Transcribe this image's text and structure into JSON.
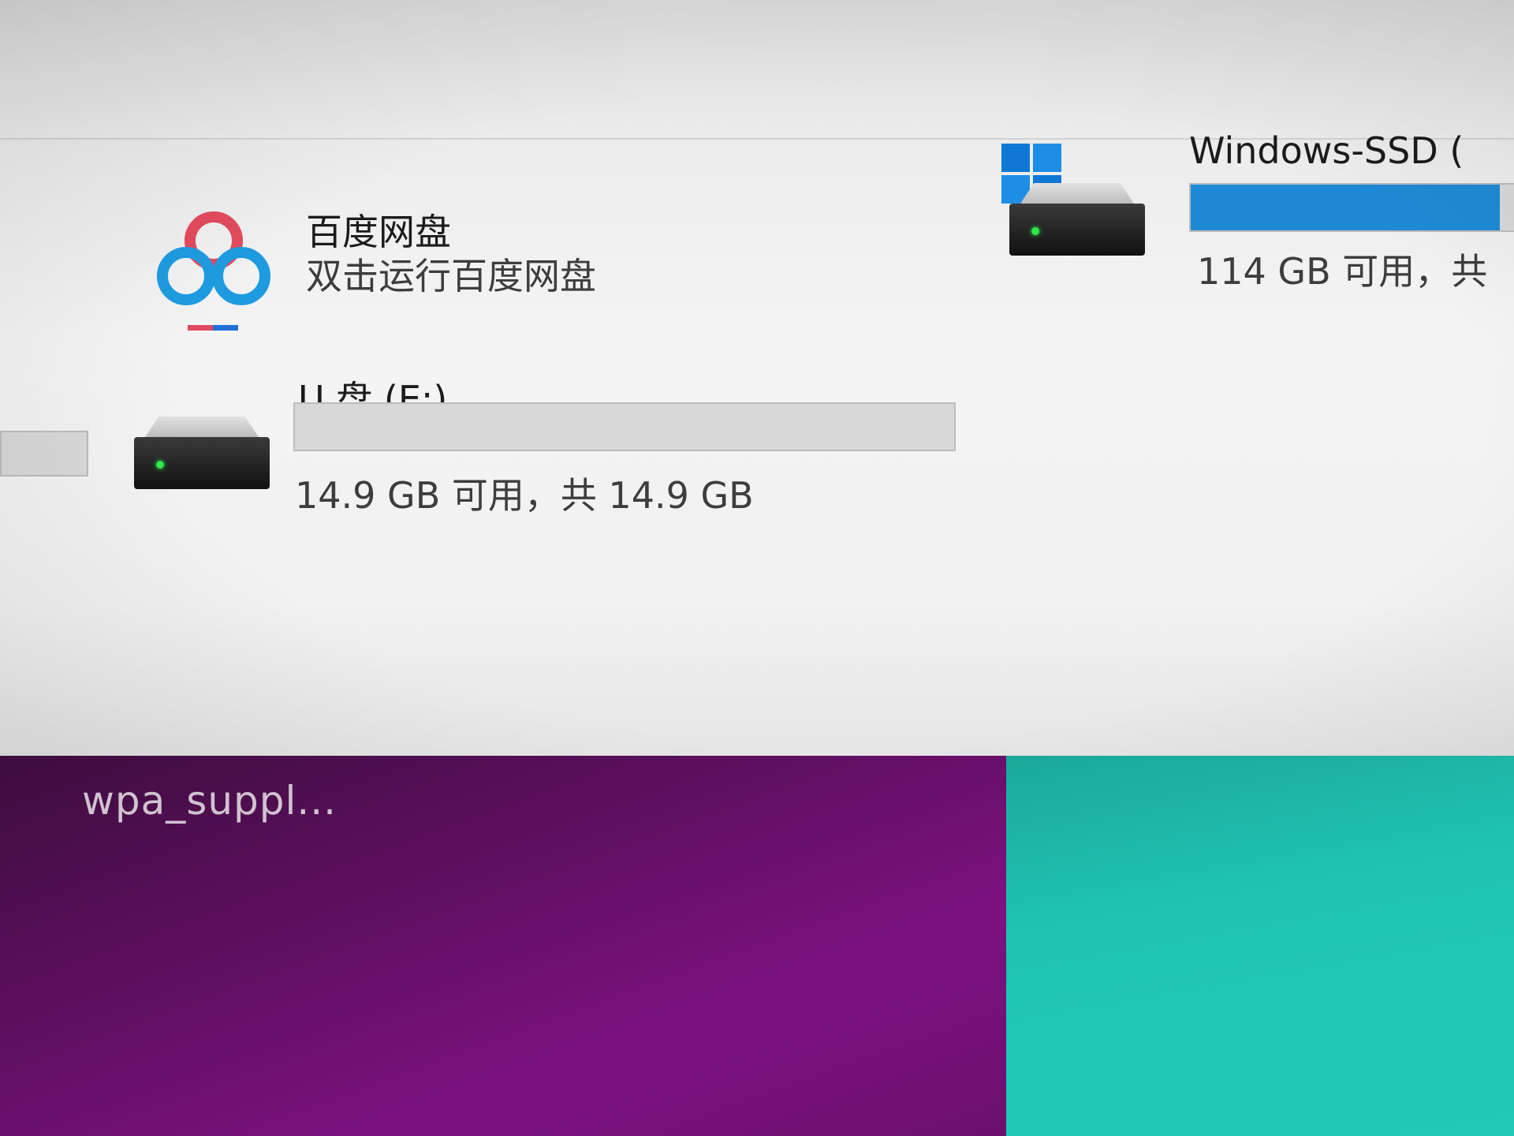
{
  "explorer": {
    "baidu": {
      "name": "百度网盘",
      "subtitle": "双击运行百度网盘"
    },
    "windows_ssd": {
      "name": "Windows-SSD (",
      "usage_text": "114 GB 可用，共",
      "used_fraction": 0.92,
      "bar_color": "#1e8ad6"
    },
    "usb": {
      "name": "U 盘 (E:)",
      "usage_text": "14.9 GB 可用，共 14.9 GB",
      "used_fraction": 0.0
    }
  },
  "desktop": {
    "task_label": "wpa_suppl...",
    "colors": {
      "purple": "#7c1280",
      "teal": "#21c9b9"
    }
  }
}
